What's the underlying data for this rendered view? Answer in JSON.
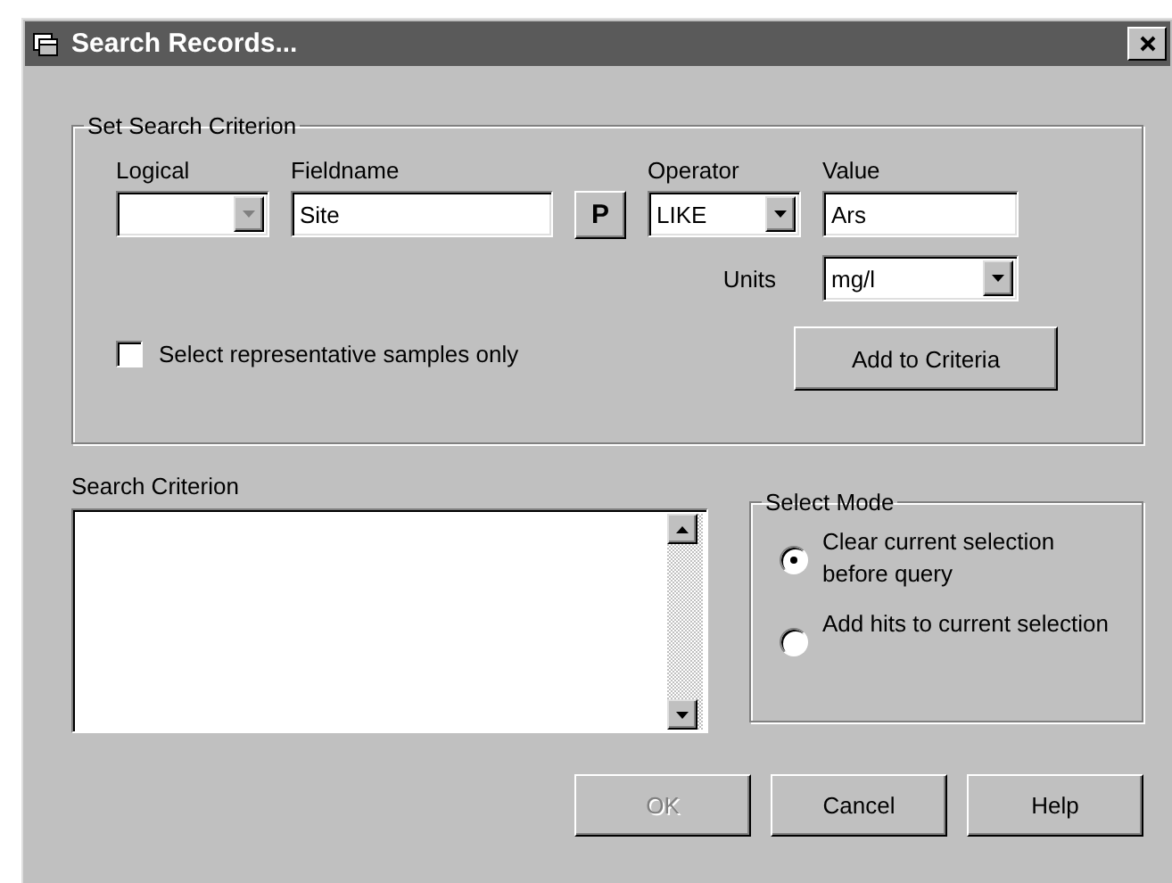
{
  "window": {
    "title": "Search Records..."
  },
  "criterion_group": {
    "title": "Set Search Criterion",
    "logical": {
      "label": "Logical",
      "disabled": true
    },
    "fieldname": {
      "label": "Fieldname",
      "value": "Site"
    },
    "pick_button": {
      "label": "P"
    },
    "operator": {
      "label": "Operator",
      "value": "LIKE"
    },
    "value": {
      "label": "Value",
      "value": "Ars"
    },
    "units": {
      "label": "Units",
      "value": "mg/l"
    },
    "representative_only": {
      "label": "Select representative samples only",
      "checked": false
    },
    "add_button": {
      "label": "Add to Criteria"
    }
  },
  "search_criterion": {
    "label": "Search Criterion"
  },
  "select_mode": {
    "title": "Select Mode",
    "options": [
      {
        "label": "Clear current selection before query",
        "selected": true
      },
      {
        "label": "Add hits to current selection",
        "selected": false
      }
    ]
  },
  "buttons": [
    {
      "label": "OK",
      "disabled": true
    },
    {
      "label": "Cancel",
      "disabled": false
    },
    {
      "label": "Help",
      "disabled": false
    }
  ]
}
